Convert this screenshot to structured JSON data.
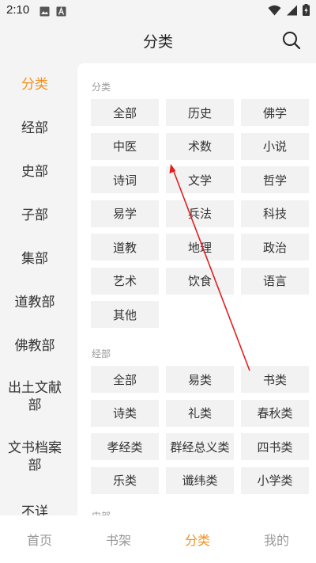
{
  "status": {
    "time": "2:10",
    "left_icons": [
      "image-icon",
      "text-a-icon"
    ],
    "right_icons": [
      "wifi-icon",
      "signal-icon",
      "battery-charging-icon"
    ]
  },
  "header": {
    "title": "分类",
    "search_icon": "search-icon"
  },
  "sidebar": {
    "items": [
      {
        "label": "分类",
        "active": true
      },
      {
        "label": "经部"
      },
      {
        "label": "史部"
      },
      {
        "label": "子部"
      },
      {
        "label": "集部"
      },
      {
        "label": "道教部"
      },
      {
        "label": "佛教部"
      },
      {
        "label": "出土文献部"
      },
      {
        "label": "文书档案部"
      },
      {
        "label": "不详"
      }
    ]
  },
  "sections": [
    {
      "title": "分类",
      "items": [
        "全部",
        "历史",
        "佛学",
        "中医",
        "术数",
        "小说",
        "诗词",
        "文学",
        "哲学",
        "易学",
        "兵法",
        "科技",
        "道教",
        "地理",
        "政治",
        "艺术",
        "饮食",
        "语言",
        "其他"
      ]
    },
    {
      "title": "经部",
      "items": [
        "全部",
        "易类",
        "书类",
        "诗类",
        "礼类",
        "春秋类",
        "孝经类",
        "群经总义类",
        "四书类",
        "乐类",
        "谶纬类",
        "小学类"
      ]
    },
    {
      "title": "史部"
    }
  ],
  "bottom_nav": {
    "items": [
      {
        "label": "首页"
      },
      {
        "label": "书架"
      },
      {
        "label": "分类",
        "active": true
      },
      {
        "label": "我的"
      }
    ]
  },
  "colors": {
    "accent": "#f0901e",
    "annotation": "#e02020",
    "chip_bg": "#f2f2f2",
    "page_bg": "#f4f4f4"
  }
}
